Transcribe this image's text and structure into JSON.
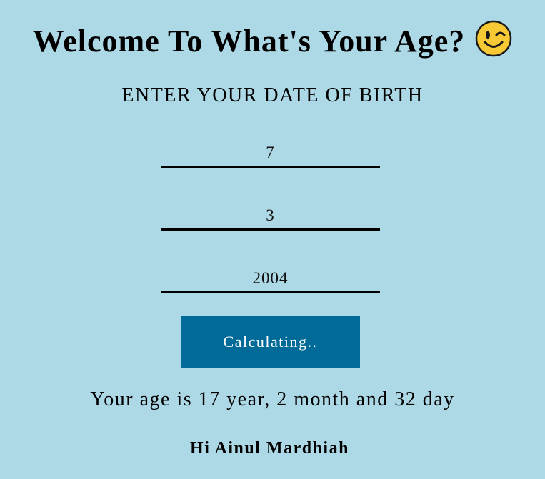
{
  "header": {
    "title": "Welcome To What's Your Age?",
    "emoji_icon": "winking-face-icon"
  },
  "form": {
    "prompt": "ENTER YOUR DATE OF BIRTH",
    "day_value": "7",
    "month_value": "3",
    "year_value": "2004",
    "button_label": "Calculating.."
  },
  "result": {
    "age_text": "Your age is 17 year, 2 month and 32 day",
    "greeting": "Hi Ainul Mardhiah"
  },
  "colors": {
    "background": "#add8e6",
    "button": "#006b99",
    "button_text": "#ffffff",
    "underline": "#000000"
  }
}
